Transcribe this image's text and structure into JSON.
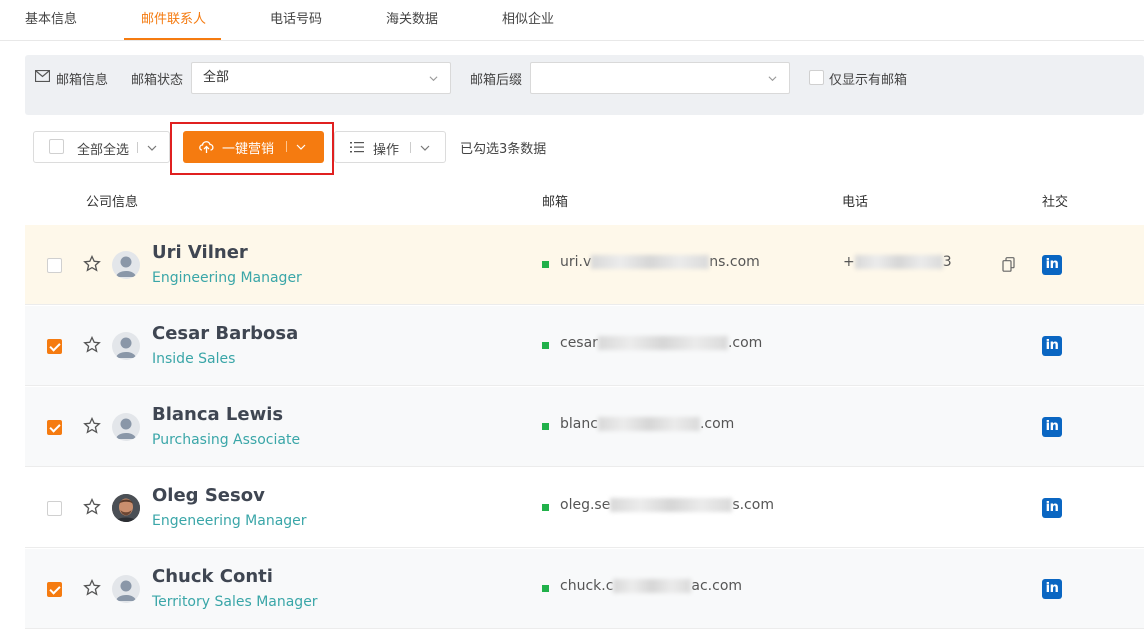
{
  "tabs": [
    "基本信息",
    "邮件联系人",
    "电话号码",
    "海关数据",
    "相似企业"
  ],
  "filters": {
    "email_info_label": "邮箱信息",
    "email_status_label": "邮箱状态",
    "email_status_value": "全部",
    "email_suffix_label": "邮箱后缀",
    "email_suffix_value": "",
    "only_with_email_label": "仅显示有邮箱"
  },
  "toolbar": {
    "select_all_label": "全部全选",
    "one_click_marketing_label": "一键营销",
    "operations_label": "操作",
    "selected_count_text": "已勾选3条数据"
  },
  "columns": [
    "公司信息",
    "邮箱",
    "电话",
    "社交"
  ],
  "contacts": [
    {
      "name": "Uri Vilner",
      "title": "Engineering Manager",
      "email_visible_start": "uri.v",
      "email_visible_end": "ns.com",
      "phone_start": "+",
      "phone_end": "3",
      "checked": false,
      "avatar": "placeholder"
    },
    {
      "name": "Cesar Barbosa",
      "title": "Inside Sales",
      "email_visible_start": "cesar",
      "email_visible_end": ".com",
      "phone_start": "",
      "phone_end": "",
      "checked": true,
      "avatar": "placeholder"
    },
    {
      "name": "Blanca Lewis",
      "title": "Purchasing Associate",
      "email_visible_start": "blanc",
      "email_visible_end": ".com",
      "phone_start": "",
      "phone_end": "",
      "checked": true,
      "avatar": "placeholder"
    },
    {
      "name": "Oleg Sesov",
      "title": "Engeneering Manager",
      "email_visible_start": "oleg.se",
      "email_visible_end": "s.com",
      "phone_start": "",
      "phone_end": "",
      "checked": false,
      "avatar": "photo"
    },
    {
      "name": "Chuck Conti",
      "title": "Territory Sales Manager",
      "email_visible_start": "chuck.c",
      "email_visible_end": "ac.com",
      "phone_start": "",
      "phone_end": "",
      "checked": true,
      "avatar": "placeholder"
    }
  ],
  "social_icon_text": "in",
  "colors": {
    "accent": "#f57b10",
    "linkedin": "#0a66c2",
    "title_teal": "#3aa6a8",
    "email_status_green": "#21b14a",
    "highlight_row": "#fef8ea"
  }
}
